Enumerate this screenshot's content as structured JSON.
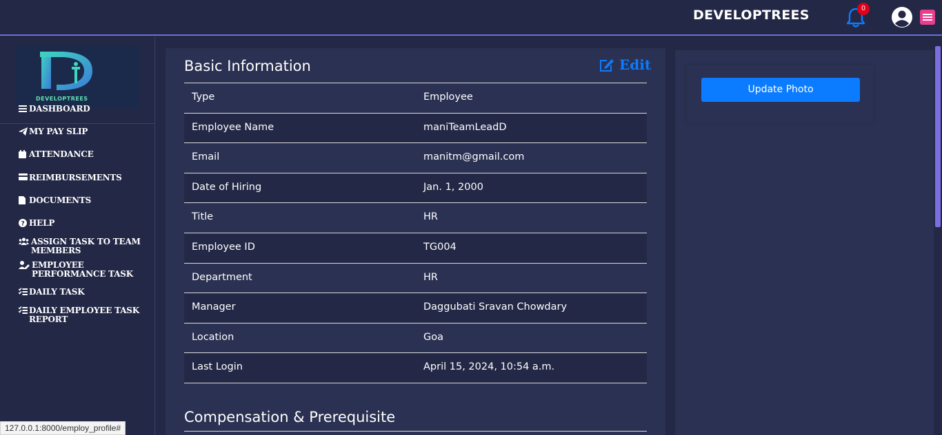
{
  "header": {
    "brand": "DEVELOPTREES",
    "notification_count": "0"
  },
  "sidebar": {
    "logo_text": "DEVELOPTREES",
    "items": [
      {
        "label": "DASHBOARD",
        "icon": "bars-icon"
      },
      {
        "label": "MY PAY SLIP",
        "icon": "paper-plane-icon"
      },
      {
        "label": "ATTENDANCE",
        "icon": "calendar-icon"
      },
      {
        "label": "REIMBURSEMENTS",
        "icon": "credit-card-icon"
      },
      {
        "label": "DOCUMENTS",
        "icon": "file-icon"
      },
      {
        "label": "HELP",
        "icon": "question-circle-icon"
      },
      {
        "label": "ASSIGN TASK TO TEAM MEMBERS",
        "icon": "users-icon"
      },
      {
        "label": "EMPLOYEE PERFORMANCE TASK",
        "icon": "user-edit-icon"
      },
      {
        "label": "DAILY TASK",
        "icon": "list-check-icon"
      },
      {
        "label": "DAILY EMPLOYEE TASK REPORT",
        "icon": "list-check-icon"
      }
    ]
  },
  "basic_info": {
    "title": "Basic Information",
    "edit_label": "Edit",
    "rows": [
      {
        "label": "Type",
        "value": "Employee"
      },
      {
        "label": "Employee Name",
        "value": "maniTeamLeadD"
      },
      {
        "label": "Email",
        "value": "manitm@gmail.com"
      },
      {
        "label": "Date of Hiring",
        "value": "Jan. 1, 2000"
      },
      {
        "label": "Title",
        "value": "HR"
      },
      {
        "label": "Employee ID",
        "value": "TG004"
      },
      {
        "label": "Department",
        "value": "HR"
      },
      {
        "label": "Manager",
        "value": "Daggubati Sravan Chowdary"
      },
      {
        "label": "Location",
        "value": "Goa"
      },
      {
        "label": "Last Login",
        "value": "April 15, 2024, 10:54 a.m."
      }
    ]
  },
  "compensation": {
    "title": "Compensation & Prerequisite"
  },
  "side_panel": {
    "update_photo_label": "Update Photo"
  },
  "status_bar": {
    "url": "127.0.0.1:8000/employ_profile#"
  },
  "colors": {
    "background": "#232846",
    "card": "#2b3152",
    "accent_blue": "#0b7cff",
    "menu_pink": "#e83e8c",
    "badge_red": "#e0001a",
    "header_border": "#6c6fd8"
  }
}
